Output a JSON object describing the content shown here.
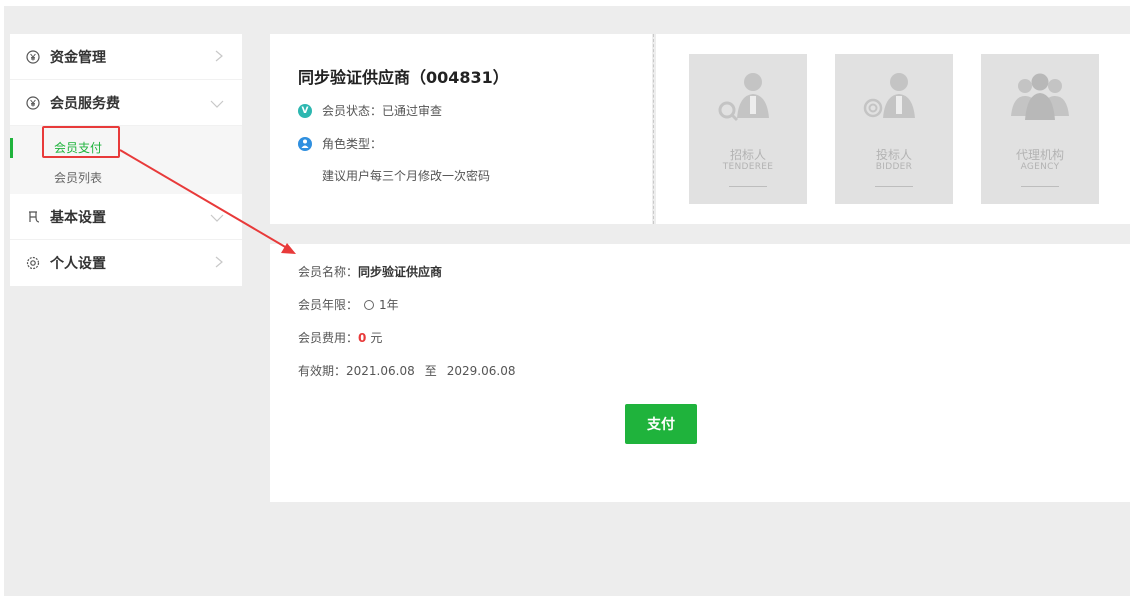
{
  "sidebar": {
    "items": [
      {
        "label": "资金管理"
      },
      {
        "label": "会员服务费"
      },
      {
        "label": "基本设置"
      },
      {
        "label": "个人设置"
      }
    ],
    "sub_items": [
      {
        "label": "会员支付"
      },
      {
        "label": "会员列表"
      }
    ]
  },
  "profile": {
    "title": "同步验证供应商（004831）",
    "status_label": "会员状态：",
    "status_value": "已通过审查",
    "role_label": "角色类型：",
    "tip": "建议用户每三个月修改一次密码"
  },
  "roles": [
    {
      "cn": "招标人",
      "en": "TENDEREE"
    },
    {
      "cn": "投标人",
      "en": "BIDDER"
    },
    {
      "cn": "代理机构",
      "en": "AGENCY"
    }
  ],
  "membership": {
    "name_label": "会员名称：",
    "name_value": "同步验证供应商",
    "term_label": "会员年限：",
    "term_option": "1年",
    "fee_label": "会员费用：",
    "fee_value": "0",
    "fee_unit": "元",
    "validity_label": "有效期：",
    "validity_start": "2021.06.08",
    "validity_sep": "至",
    "validity_end": "2029.06.08",
    "pay_button": "支付"
  },
  "colors": {
    "accent": "#1fb33c",
    "highlight": "#e83a3a"
  }
}
